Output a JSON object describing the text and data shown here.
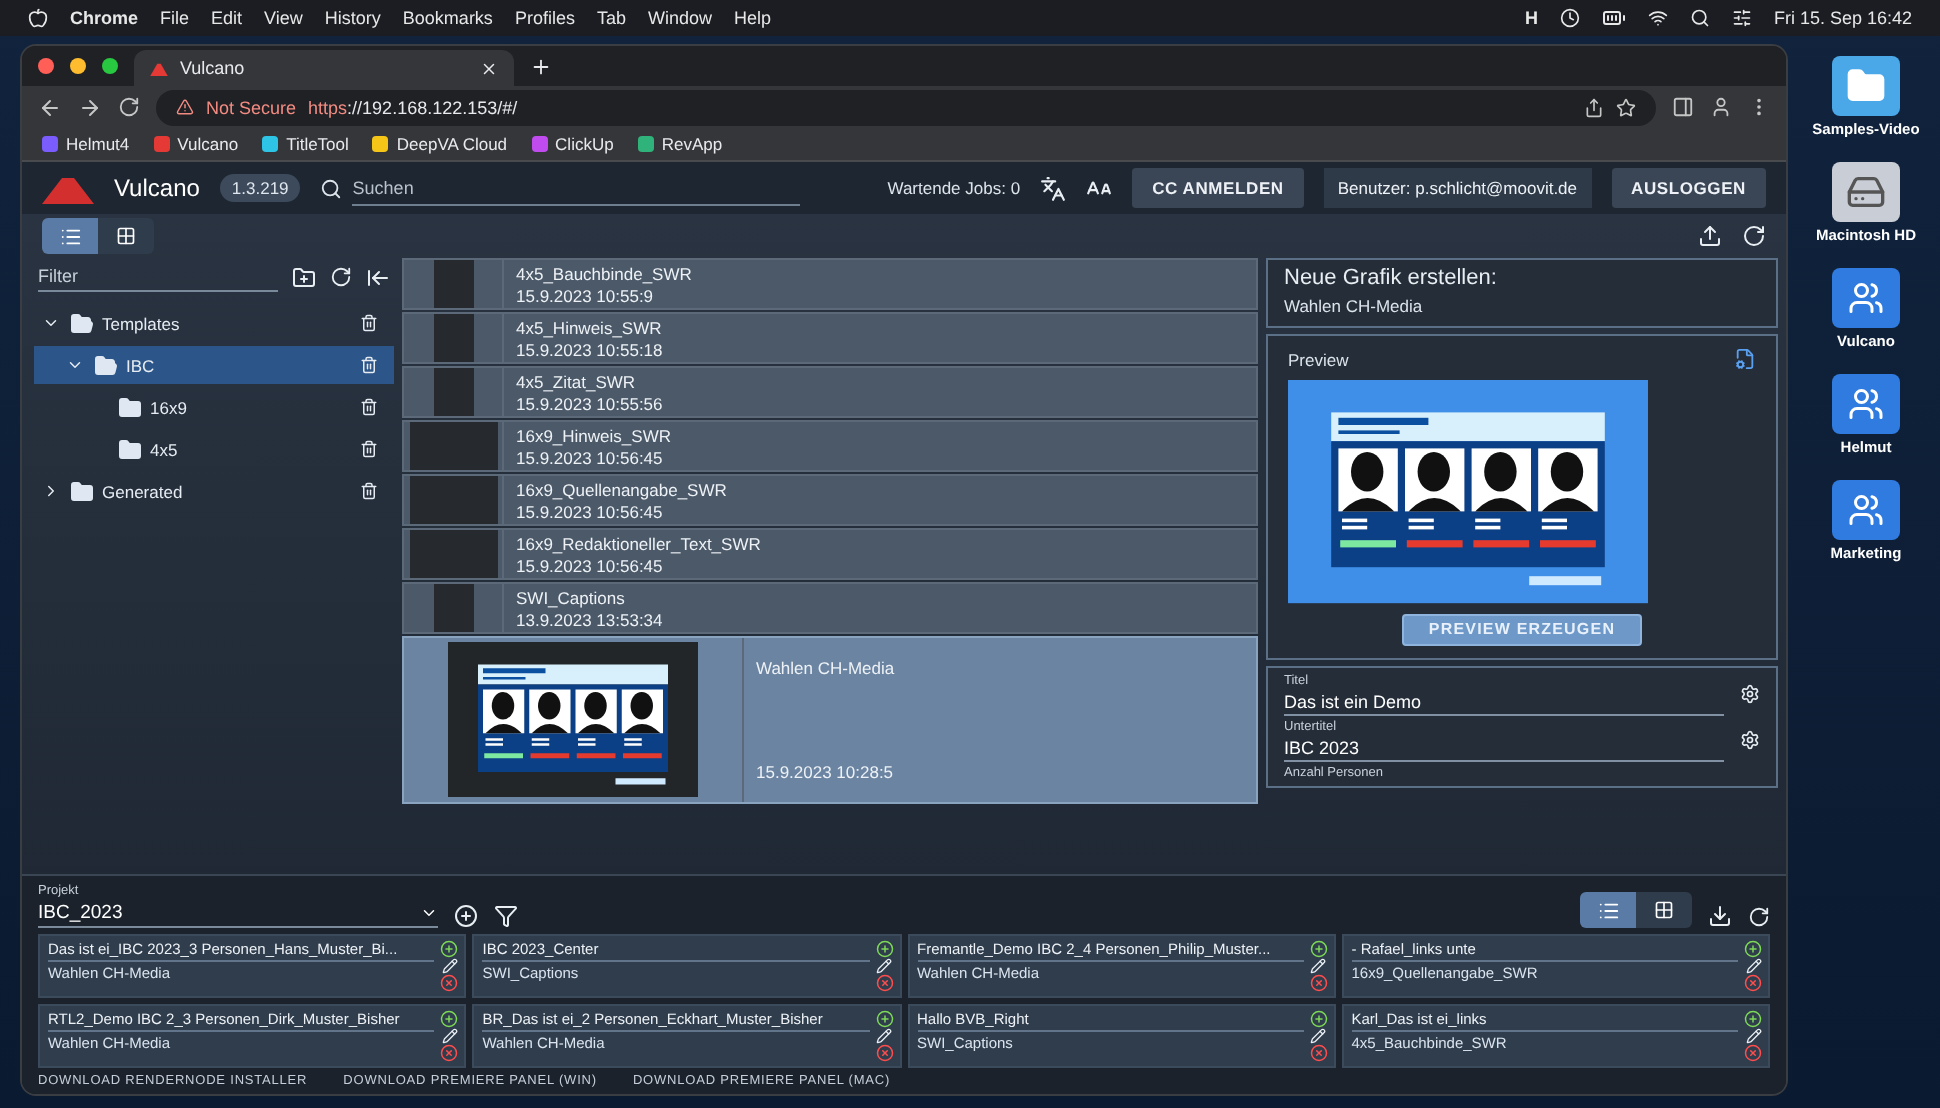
{
  "menubar": {
    "app": "Chrome",
    "items": [
      "File",
      "Edit",
      "View",
      "History",
      "Bookmarks",
      "Profiles",
      "Tab",
      "Window",
      "Help"
    ],
    "status_letter": "H",
    "clock": "Fri 15. Sep 16:42"
  },
  "browser": {
    "tab": "Vulcano",
    "security": "Not Secure",
    "url_scheme": "https",
    "url_rest": "://192.168.122.153/#/",
    "bookmarks": [
      {
        "label": "Helmut4",
        "color": "#7a5cff"
      },
      {
        "label": "Vulcano",
        "color": "#e53935"
      },
      {
        "label": "TitleTool",
        "color": "#2ec4e6"
      },
      {
        "label": "DeepVA Cloud",
        "color": "#f5c518"
      },
      {
        "label": "ClickUp",
        "color": "#c04cf0"
      },
      {
        "label": "RevApp",
        "color": "#2fb37a"
      }
    ]
  },
  "header": {
    "brand": "Vulcano",
    "version": "1.3.219",
    "search": {
      "placeholder": "Suchen"
    },
    "jobs": "Wartende Jobs: 0",
    "cc_button": "CC ANMELDEN",
    "user": "Benutzer: p.schlicht@moovit.de",
    "logout": "AUSLOGGEN"
  },
  "view_toggle": [
    {
      "kind": "list",
      "selected": true
    },
    {
      "kind": "grid",
      "selected": false
    }
  ],
  "sidebar": {
    "filter": {
      "placeholder": "Filter"
    },
    "tree": [
      {
        "label": "Templates",
        "expanded": true,
        "selected": false,
        "children": [
          {
            "label": "IBC",
            "expanded": true,
            "selected": true,
            "children": [
              {
                "label": "16x9",
                "selected": false
              },
              {
                "label": "4x5",
                "selected": false
              }
            ]
          }
        ]
      },
      {
        "label": "Generated",
        "expanded": false,
        "selected": false
      }
    ]
  },
  "templates": [
    {
      "name": "4x5_Bauchbinde_SWR",
      "date": "15.9.2023 10:55:9",
      "kind": "portrait",
      "selected": false
    },
    {
      "name": "4x5_Hinweis_SWR",
      "date": "15.9.2023 10:55:18",
      "kind": "portrait",
      "selected": false
    },
    {
      "name": "4x5_Zitat_SWR",
      "date": "15.9.2023 10:55:56",
      "kind": "portrait",
      "selected": false
    },
    {
      "name": "16x9_Hinweis_SWR",
      "date": "15.9.2023 10:56:45",
      "kind": "landscape",
      "selected": false
    },
    {
      "name": "16x9_Quellenangabe_SWR",
      "date": "15.9.2023 10:56:45",
      "kind": "landscape",
      "selected": false
    },
    {
      "name": "16x9_Redaktioneller_Text_SWR",
      "date": "15.9.2023 10:56:45",
      "kind": "landscape",
      "selected": false
    },
    {
      "name": "SWI_Captions",
      "date": "13.9.2023 13:53:34",
      "kind": "portrait",
      "selected": false
    },
    {
      "name": "Wahlen CH-Media",
      "date": "15.9.2023 10:28:5",
      "kind": "graphic",
      "selected": true
    }
  ],
  "editor": {
    "heading": "Neue Grafik erstellen:",
    "template": "Wahlen CH-Media",
    "preview_title": "Preview",
    "preview_button": "PREVIEW ERZEUGEN",
    "fields": [
      {
        "label": "Titel",
        "value": "Das ist ein Demo"
      },
      {
        "label": "Untertitel",
        "value": "IBC 2023"
      }
    ],
    "next_label": "Anzahl Personen"
  },
  "project": {
    "label": "Projekt",
    "value": "IBC_2023"
  },
  "jobs": [
    {
      "title": "Das ist ei_IBC 2023_3 Personen_Hans_Muster_Bi...",
      "template": "Wahlen CH-Media"
    },
    {
      "title": "IBC 2023_Center",
      "template": "SWI_Captions"
    },
    {
      "title": "Fremantle_Demo IBC 2_4 Personen_Philip_Muster...",
      "template": "Wahlen CH-Media"
    },
    {
      "title": "- Rafael_links unte",
      "template": "16x9_Quellenangabe_SWR"
    },
    {
      "title": "RTL2_Demo IBC 2_3 Personen_Dirk_Muster_Bisher",
      "template": "Wahlen CH-Media"
    },
    {
      "title": "BR_Das ist ei_2 Personen_Eckhart_Muster_Bisher",
      "template": "Wahlen CH-Media"
    },
    {
      "title": "Hallo BVB_Right",
      "template": "SWI_Captions"
    },
    {
      "title": "Karl_Das ist ei_links",
      "template": "4x5_Bauchbinde_SWR"
    }
  ],
  "footer_links": [
    "DOWNLOAD RENDERNODE INSTALLER",
    "DOWNLOAD PREMIERE PANEL (WIN)",
    "DOWNLOAD PREMIERE PANEL (MAC)"
  ],
  "desktop": [
    {
      "label": "Samples-Video",
      "kind": "folder"
    },
    {
      "label": "Macintosh HD",
      "kind": "disk"
    },
    {
      "label": "Vulcano",
      "kind": "share"
    },
    {
      "label": "Helmut",
      "kind": "share"
    },
    {
      "label": "Marketing",
      "kind": "share"
    }
  ]
}
